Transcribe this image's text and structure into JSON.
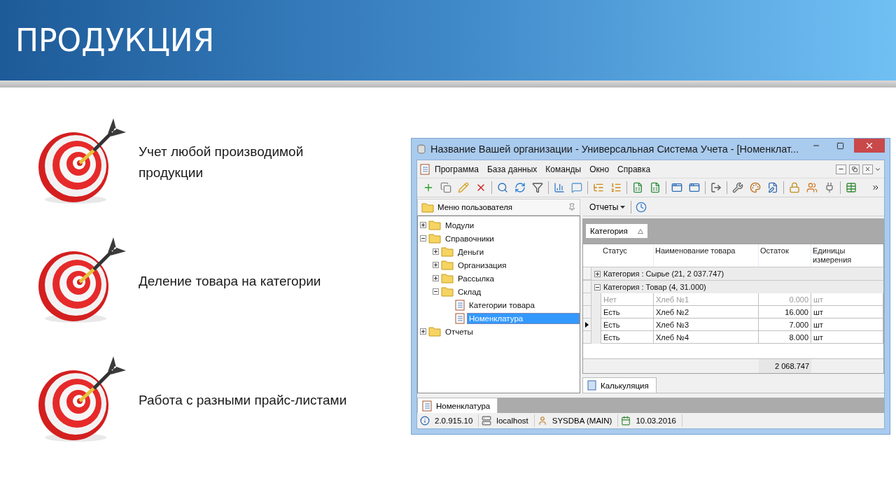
{
  "slide": {
    "title": "ПРОДУКЦИЯ"
  },
  "bullets": [
    {
      "text": "Учет любой производимой продукции"
    },
    {
      "text": "Деление товара на категории"
    },
    {
      "text": "Работа с разными прайс-листами"
    }
  ],
  "window": {
    "title": "Название Вашей организации - Универсальная Система Учета - [Номенклат...",
    "menu": [
      "Программа",
      "База данных",
      "Команды",
      "Окно",
      "Справка"
    ],
    "tree_panel": {
      "title": "Меню пользователя",
      "items": [
        {
          "label": "Модули",
          "kind": "folder",
          "expanded": false,
          "selected": false
        },
        {
          "label": "Справочники",
          "kind": "folder",
          "expanded": true,
          "selected": false,
          "children": [
            {
              "label": "Деньги",
              "kind": "folder",
              "expanded": false,
              "selected": false
            },
            {
              "label": "Организация",
              "kind": "folder",
              "expanded": false,
              "selected": false
            },
            {
              "label": "Рассылка",
              "kind": "folder",
              "expanded": false,
              "selected": false
            },
            {
              "label": "Склад",
              "kind": "folder",
              "expanded": true,
              "selected": false,
              "children": [
                {
                  "label": "Категории товара",
                  "kind": "document",
                  "selected": false
                },
                {
                  "label": "Номенклатура",
                  "kind": "document",
                  "selected": true
                }
              ]
            }
          ]
        },
        {
          "label": "Отчеты",
          "kind": "folder",
          "expanded": false,
          "selected": false
        }
      ]
    },
    "reports_button": "Отчеты",
    "group_chip": "Категория",
    "table": {
      "columns": [
        "Статус",
        "Наименование товара",
        "Остаток",
        "Единицы измерения"
      ],
      "groups": [
        {
          "label": "Категория : Сырье (21, 2 037.747)",
          "expanded": false
        },
        {
          "label": "Категория : Товар (4, 31.000)",
          "expanded": true,
          "rows": [
            {
              "status": "Нет",
              "name": "Хлеб №1",
              "qty": "0.000",
              "unit": "шт",
              "disabled": true,
              "selected": false
            },
            {
              "status": "Есть",
              "name": "Хлеб №2",
              "qty": "16.000",
              "unit": "шт",
              "disabled": false,
              "selected": false
            },
            {
              "status": "Есть",
              "name": "Хлеб №3",
              "qty": "7.000",
              "unit": "шт",
              "disabled": false,
              "selected": true
            },
            {
              "status": "Есть",
              "name": "Хлеб №4",
              "qty": "8.000",
              "unit": "шт",
              "disabled": false,
              "selected": false
            }
          ]
        }
      ],
      "total": "2 068.747"
    },
    "detail_tab": "Калькуляция",
    "document_tab": "Номенклатура",
    "status_bar": {
      "version": "2.0.915.10",
      "server": "localhost",
      "user": "SYSDBA (MAIN)",
      "date": "10.03.2016"
    }
  }
}
